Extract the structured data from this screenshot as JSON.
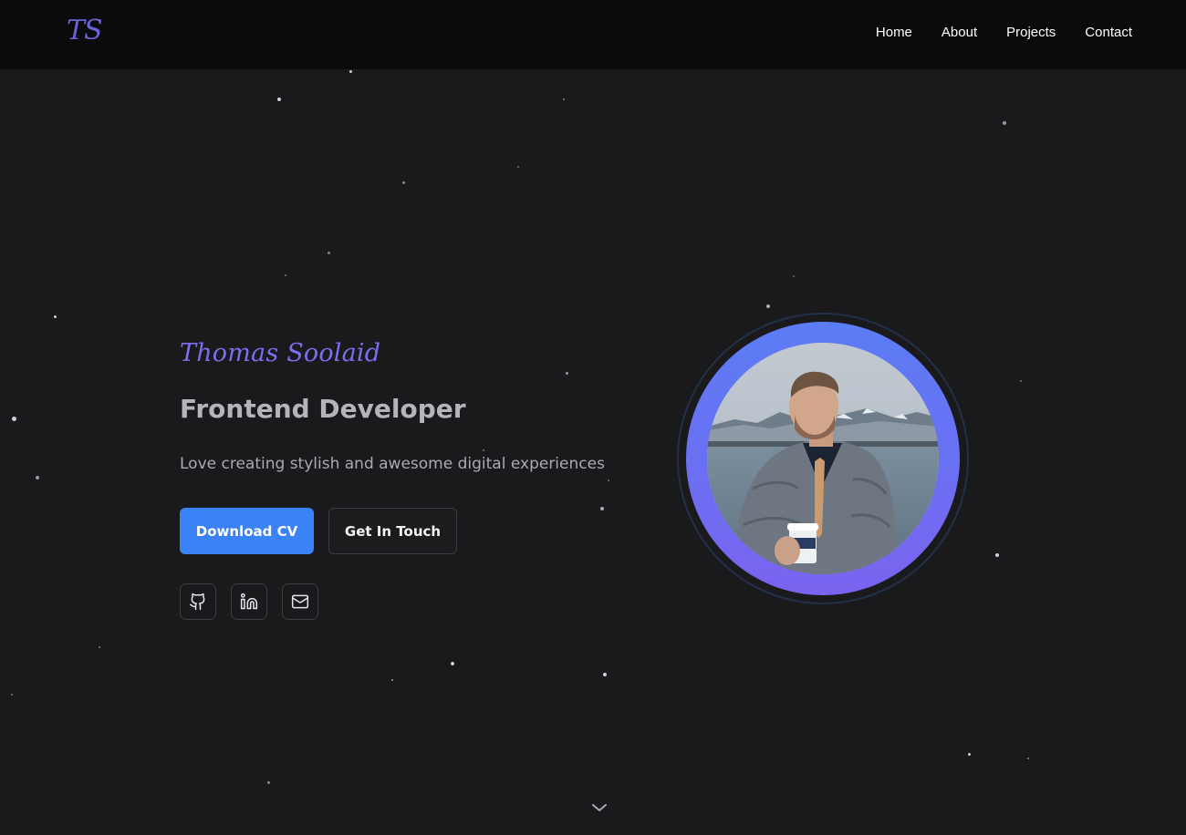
{
  "nav": {
    "logo": "TS",
    "links": [
      "Home",
      "About",
      "Projects",
      "Contact"
    ]
  },
  "hero": {
    "name": "Thomas Soolaid",
    "role": "Frontend Developer",
    "tagline": "Love creating stylish and awesome digital experiences",
    "primary_button": "Download CV",
    "secondary_button": "Get In Touch"
  },
  "social": [
    "github-icon",
    "linkedin-icon",
    "mail-icon"
  ],
  "colors": {
    "accent": "#3b82f6",
    "name": "#7b6ff0",
    "logo": "#6d63d9",
    "background": "#1a1a1c",
    "navbar": "#0b0b0b",
    "ring_top": "#5b7cf5",
    "ring_bottom": "#7a63ef"
  }
}
